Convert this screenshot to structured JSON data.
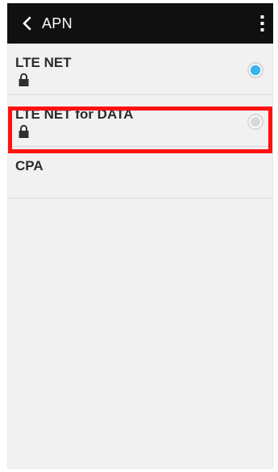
{
  "header": {
    "title": "APN",
    "back_icon": "back-arrow-icon",
    "menu_icon": "more-vertical-icon"
  },
  "colors": {
    "header_background": "#101010",
    "panel_background": "#f1f1f1",
    "selected_radio": "#3ab4eb",
    "highlight": "#ff1111",
    "divider": "#d7d7d7"
  },
  "apn_items": [
    {
      "label": "LTE NET",
      "locked": true,
      "lock_icon": "lock-icon",
      "selected": true
    },
    {
      "label": "LTE NET for DATA",
      "locked": true,
      "lock_icon": "lock-icon",
      "selected": false
    },
    {
      "label": "CPA",
      "locked": false,
      "selected": false,
      "highlighted": true
    }
  ]
}
